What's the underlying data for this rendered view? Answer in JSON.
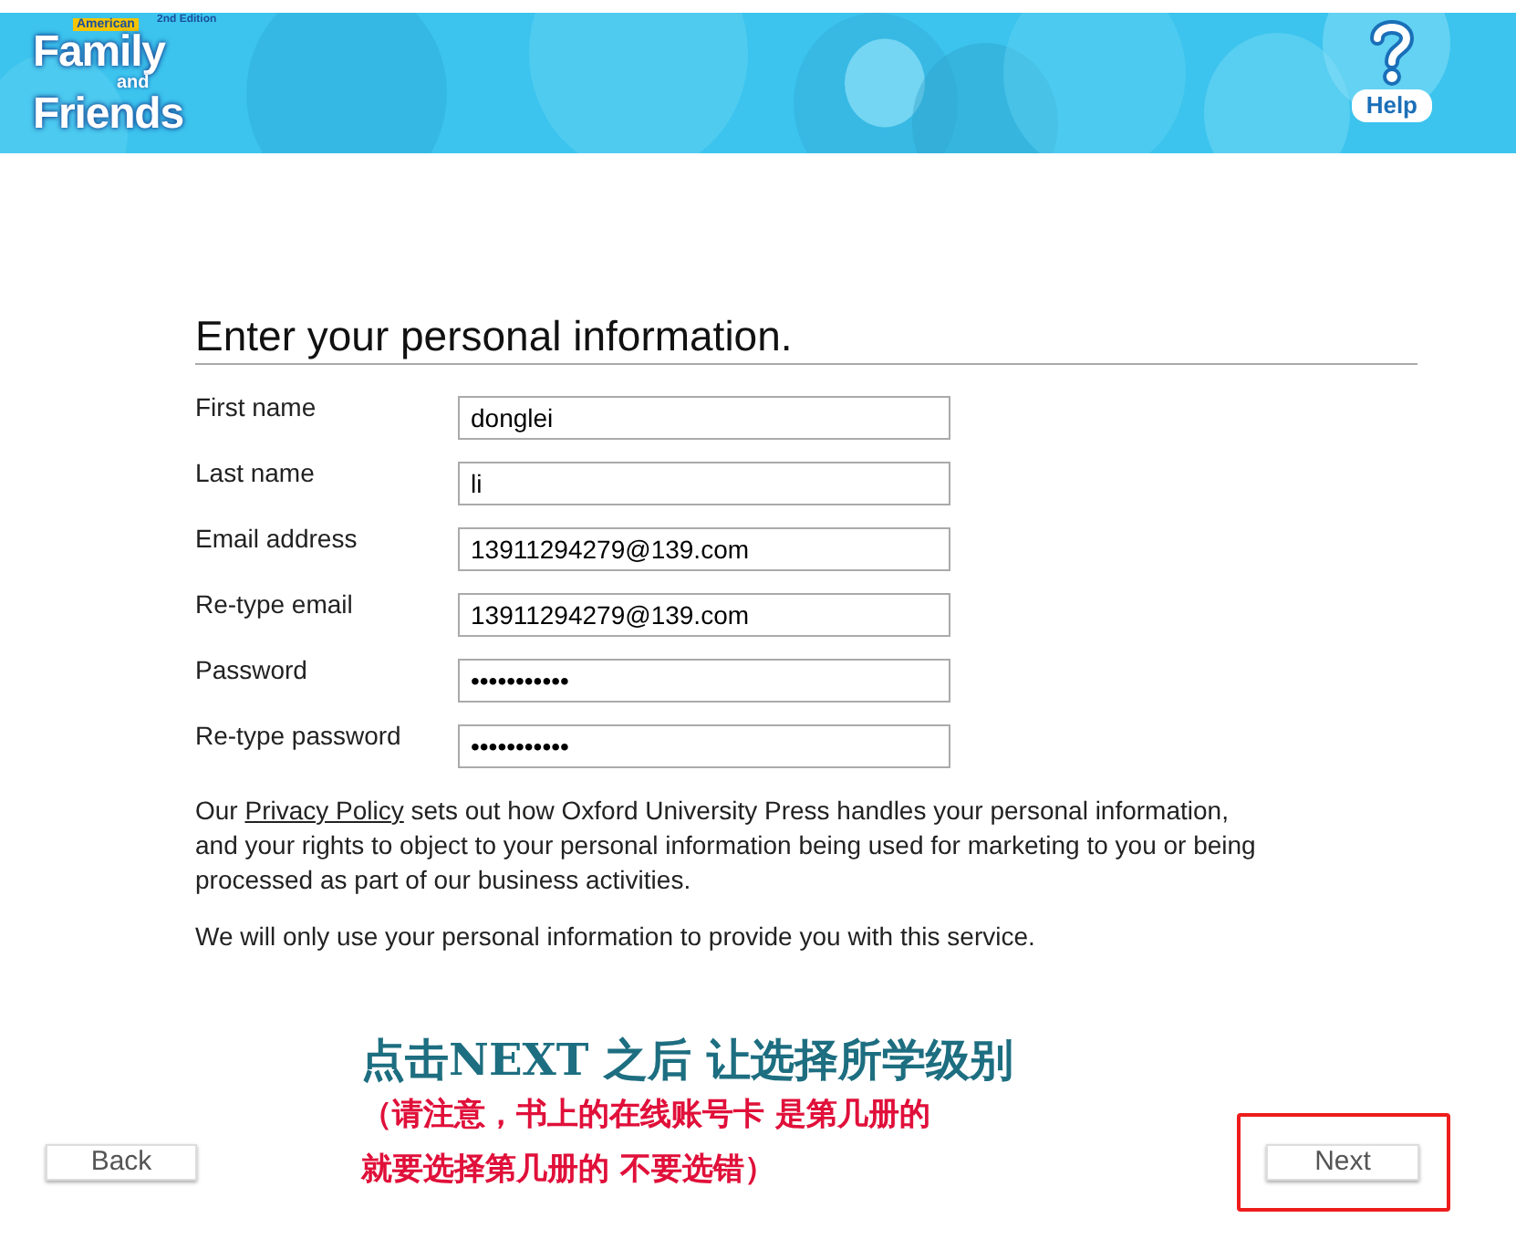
{
  "header": {
    "logo": {
      "badge": "American",
      "edition": "2nd Edition",
      "line_1": "Family",
      "line_2": "and",
      "line_3": "Friends"
    },
    "help": {
      "label": "Help"
    }
  },
  "form": {
    "title": "Enter your personal information.",
    "fields": [
      {
        "label": "First name",
        "value": "donglei"
      },
      {
        "label": "Last name",
        "value": "li"
      },
      {
        "label": "Email address",
        "value": "13911294279@139.com"
      },
      {
        "label": "Re-type email",
        "value": "13911294279@139.com"
      },
      {
        "label": "Password",
        "value": "•••••••••••"
      },
      {
        "label": "Re-type password",
        "value": "•••••••••••"
      }
    ],
    "privacy": {
      "before": "Our ",
      "link": "Privacy Policy",
      "after": " sets out how Oxford University Press handles your personal information, and your rights to object to your personal information being used for marketing to you or being processed as part of our business activities."
    },
    "notice": "We will only use your personal information to provide you with this service."
  },
  "annotation": {
    "heading": "点击NEXT 之后 让选择所学级别",
    "note_lines": [
      "（请注意，书上的在线账号卡 是第几册的",
      "就要选择第几册的 不要选错）"
    ]
  },
  "buttons": {
    "back": "Back",
    "next": "Next",
    "next_highlighted": true
  }
}
